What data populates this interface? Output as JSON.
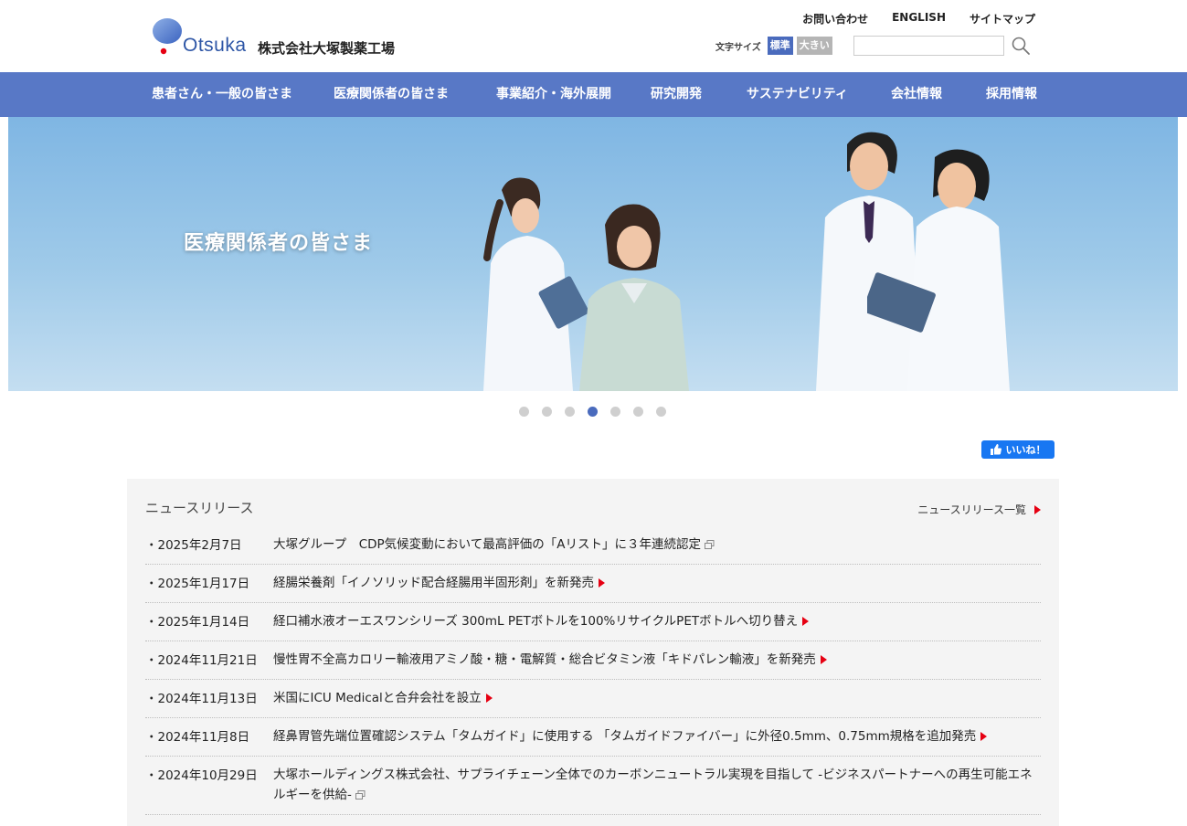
{
  "header": {
    "logo_text": "Otsuka",
    "company_name": "株式会社大塚製薬工場",
    "util_links": [
      "お問い合わせ",
      "ENGLISH",
      "サイトマップ"
    ],
    "font_size_label": "文字サイズ",
    "font_size_standard": "標準",
    "font_size_large": "大きい",
    "search_placeholder": ""
  },
  "nav": {
    "items": [
      "患者さん・一般の皆さま",
      "医療関係者の皆さま",
      "事業紹介・海外展開",
      "研究開発",
      "サステナビリティ",
      "会社情報",
      "採用情報"
    ]
  },
  "hero": {
    "title": "医療関係者の皆さま",
    "slide_count": 7,
    "active_slide": 4
  },
  "social": {
    "like_label": "いいね！"
  },
  "news": {
    "title": "ニュースリリース",
    "all_link": "ニュースリリース一覧",
    "items": [
      {
        "date": "・2025年2月7日",
        "text": "大塚グループ　CDP気候変動において最高評価の「Aリスト」に３年連続認定",
        "icon": "external-link-icon"
      },
      {
        "date": "・2025年1月17日",
        "text": "経腸栄養剤「イノソリッド配合経腸用半固形剤」を新発売",
        "icon": "arrow-right-icon"
      },
      {
        "date": "・2025年1月14日",
        "text": "経口補水液オーエスワンシリーズ 300mL PETボトルを100%リサイクルPETボトルへ切り替え",
        "icon": "arrow-right-icon"
      },
      {
        "date": "・2024年11月21日",
        "text": "慢性胃不全高カロリー輸液用アミノ酸・糖・電解質・総合ビタミン液「キドパレン輸液」を新発売",
        "icon": "arrow-right-icon"
      },
      {
        "date": "・2024年11月13日",
        "text": "米国にICU Medicalと合弁会社を設立",
        "icon": "arrow-right-icon"
      },
      {
        "date": "・2024年11月8日",
        "text": "経鼻胃管先端位置確認システム「タムガイド」に使用する 「タムガイドファイバー」に外径0.5mm、0.75mm規格を追加発売",
        "icon": "arrow-right-icon"
      },
      {
        "date": "・2024年10月29日",
        "text": "大塚ホールディングス株式会社、サプライチェーン全体でのカーボンニュートラル実現を目指して -ビジネスパートナーへの再生可能エネルギーを供給-",
        "icon": "external-link-icon"
      }
    ]
  },
  "colors": {
    "nav_bg": "#5878c6",
    "accent": "#4a6bbd",
    "arrow": "#e60012",
    "news_bg": "#f4f4f4"
  }
}
